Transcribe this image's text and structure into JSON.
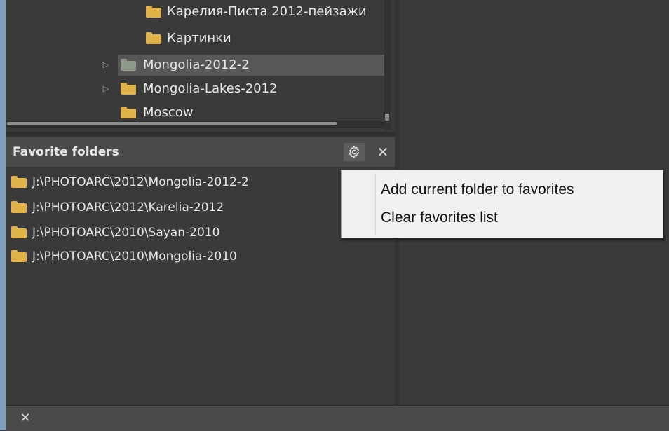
{
  "tree": {
    "items": [
      {
        "label": "Карелия-Писта 2012-пейзажи",
        "expandable": false,
        "selected": false,
        "icon": "folder-icon"
      },
      {
        "label": "Картинки",
        "expandable": false,
        "selected": false,
        "icon": "folder-icon"
      },
      {
        "label": "Mongolia-2012-2",
        "expandable": true,
        "selected": true,
        "icon": "folder-icon"
      },
      {
        "label": "Mongolia-Lakes-2012",
        "expandable": true,
        "selected": false,
        "icon": "folder-icon"
      },
      {
        "label": "Moscow",
        "expandable": false,
        "selected": false,
        "icon": "folder-icon"
      }
    ],
    "expander_glyph": "▷"
  },
  "favorites": {
    "title": "Favorite folders",
    "settings_icon": "gear-icon",
    "close_glyph": "✕",
    "items": [
      "J:\\PHOTOARC\\2012\\Mongolia-2012-2",
      "J:\\PHOTOARC\\2012\\Karelia-2012",
      "J:\\PHOTOARC\\2010\\Sayan-2010",
      "J:\\PHOTOARC\\2010\\Mongolia-2010"
    ]
  },
  "context_menu": {
    "items": [
      "Add current folder to favorites",
      "Clear favorites list"
    ]
  },
  "bottom_bar": {
    "close_glyph": "✕"
  },
  "colors": {
    "background": "#3a3a3a",
    "header": "#4a4a4a",
    "selected_row": "#575757",
    "folder": "#e2b24a",
    "folder_selected": "#8f9a8b",
    "left_edge": "#7f9fbf",
    "menu_background": "#f0f0f0"
  }
}
